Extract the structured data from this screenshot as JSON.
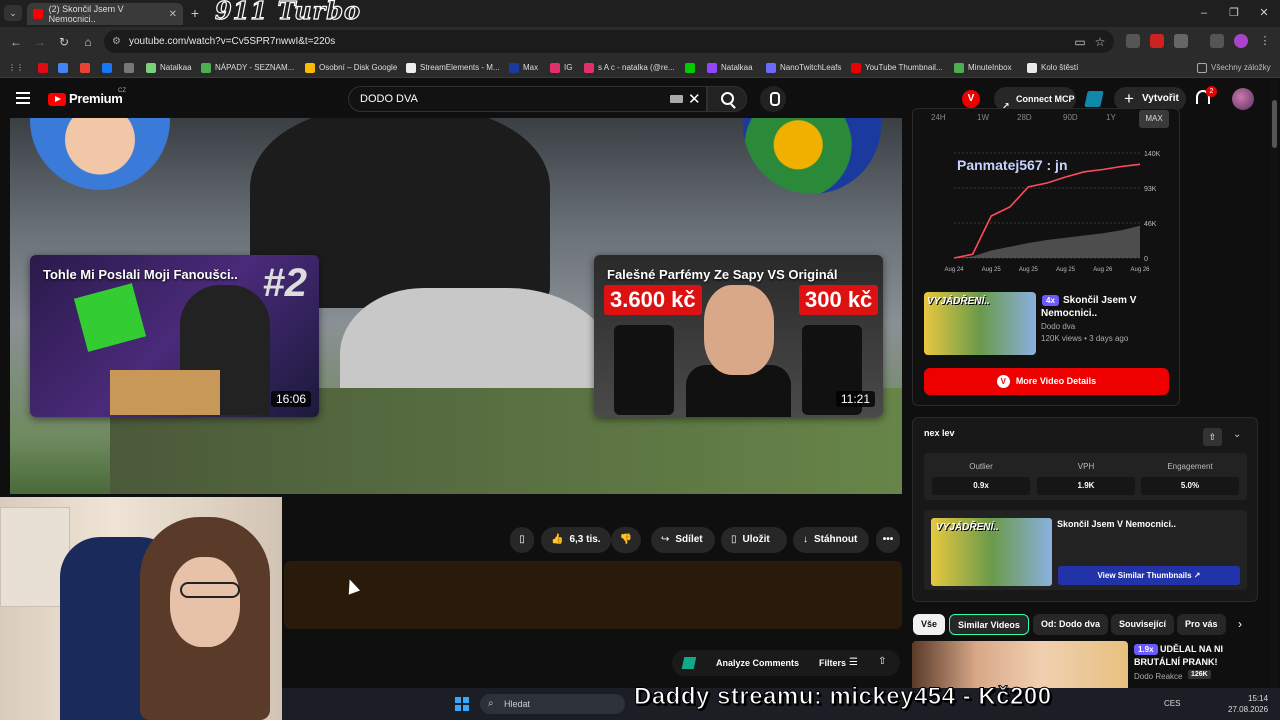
{
  "browser": {
    "tab_title": "(2) Skončil Jsem V Nemocnici..",
    "overlay_title": "911 Turbo",
    "url": "youtube.com/watch?v=Cv5SPR7nwwI&t=220s",
    "bookmarks": [
      "Natalkaa",
      "NÁPADY - SEZNAM...",
      "Osobní – Disk Google",
      "StreamElements - M...",
      "Max",
      "IG",
      "s A c - natalka (@re...",
      "Natalkaa",
      "NanoTwitchLeafs",
      "YouTube Thumbnail...",
      "MinuteInbox",
      "Kolo štěstí",
      "Všechny záložky"
    ],
    "bookmark_colors": [
      "#7bd17b",
      "#4caf50",
      "#fbbc04",
      "#eeeeee",
      "#1a3aa0",
      "#e1306c",
      "#e1306c",
      "#9146ff",
      "#6a6aff",
      "#e00000",
      "#4caf50",
      "#e8e8e8",
      "#aaaaaa"
    ]
  },
  "youtube": {
    "logo_text": "Premium",
    "region": "CZ",
    "search_value": "DODO DVA",
    "v_badge": "V",
    "connect_label": "Connect MCP",
    "create_label": "Vytvořit",
    "notif_count": "2"
  },
  "video": {
    "endcards": [
      {
        "title": "Tohle Mi Poslali Moji Fanoušci..",
        "duration": "16:06",
        "number": "#2"
      },
      {
        "title": "Falešné Parfémy Ze Sapy VS Originál",
        "duration": "11:21",
        "price_left": "3.600 kč",
        "price_right": "300 kč"
      }
    ]
  },
  "actions": {
    "likes": "6,3 tis.",
    "share": "Sdílet",
    "save": "Uložit",
    "download": "Stáhnout"
  },
  "comments_bar": {
    "analyze": "Analyze Comments",
    "filters": "Filters"
  },
  "sidebar": {
    "ranges": [
      "24H",
      "1W",
      "28D",
      "90D",
      "1Y",
      "MAX"
    ],
    "stats_card": {
      "thumb_tag": "VYJÁDŘENÍ..",
      "outlier": "4x",
      "title": "Skončil Jsem V Nemocnici..",
      "channel": "Dodo dva",
      "meta": "120K views • 3 days ago",
      "details_button": "More Video Details"
    },
    "nexlev": {
      "logo": "nex lev",
      "outlier_label": "Outlier",
      "outlier_value": "0.9x",
      "vph_label": "VPH",
      "vph_value": "1.9K",
      "engagement_label": "Engagement",
      "engagement_value": "5.0%",
      "similar_thumb_tag": "VYJÁDŘENÍ..",
      "similar_title": "Skončil Jsem V Nemocnici..",
      "view_similar": "View Similar Thumbnails"
    },
    "chips": [
      "Vše",
      "Similar Videos",
      "Od: Dodo dva",
      "Související",
      "Pro vás"
    ],
    "rec1": {
      "outlier": "1.9x",
      "title": "UDĚLAL NA NI BRUTÁLNÍ PRANK!",
      "channel": "Dodo Reakce",
      "views": "126K"
    }
  },
  "chart_data": {
    "type": "area",
    "title": "Panmatej567 : jn",
    "x": [
      "Aug 24",
      "Aug 25",
      "Aug 25",
      "Aug 25",
      "Aug 26",
      "Aug 26"
    ],
    "y_ticks": [
      "140K",
      "93K",
      "46K",
      "0"
    ],
    "ylim": [
      0,
      140000
    ],
    "series": [
      {
        "color": "#ff4b5c",
        "values": [
          0,
          5000,
          56000,
          68000,
          95000,
          100000,
          108000,
          115000,
          118000,
          122000,
          125000
        ]
      },
      {
        "color": "#666666",
        "values": [
          0,
          2000,
          10000,
          15000,
          20000,
          24000,
          27000,
          30000,
          33000,
          37000,
          43000
        ]
      }
    ],
    "grid": true
  },
  "taskbar": {
    "search_placeholder": "Hledat",
    "donation": "Daddy streamu: mickey454 - Kč200",
    "language": "CES",
    "time": "15:14",
    "date": "27.08.2026"
  }
}
